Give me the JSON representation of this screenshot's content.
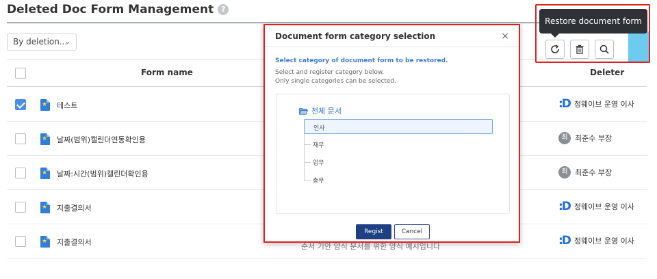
{
  "page": {
    "title": "Deleted Doc Form Management",
    "help_icon": "question-circle-icon"
  },
  "filter": {
    "sort_value": "By deletion..."
  },
  "table": {
    "headers": {
      "form_name": "Form name",
      "deleter": "Deleter"
    },
    "rows": [
      {
        "checked": true,
        "name": "테스트",
        "deleter": "정웨이브 운영 이사",
        "avatar": "D"
      },
      {
        "checked": false,
        "name": "날짜(범위)캘린더연동확인용",
        "deleter": "최준수 부장",
        "avatar": "최"
      },
      {
        "checked": false,
        "name": "날짜:시간(범위)캘린더확인용",
        "deleter": "최준수 부장",
        "avatar": "최"
      },
      {
        "checked": false,
        "name": "지출결의서",
        "deleter": "정웨이브 운영 이사",
        "avatar": "D"
      },
      {
        "checked": false,
        "name": "지출결의서",
        "deleter": "정웨이브 운영 이사",
        "avatar": "D"
      }
    ]
  },
  "toolbar": {
    "tooltip": "Restore document form",
    "restore_icon": "restore-icon",
    "delete_icon": "trash-icon",
    "search_icon": "search-icon"
  },
  "modal": {
    "title": "Document form category selection",
    "instruction": "Select category of document form to be restored.",
    "desc1": "Select and register category below.",
    "desc2": "Only single categories can be selected.",
    "tree": {
      "root": "전체 문서",
      "items": [
        "인사",
        "재무",
        "업무",
        "총무"
      ],
      "selected_index": 0
    },
    "regist_label": "Regist",
    "cancel_label": "Cancel"
  },
  "background_text": "순서 기안 양식 문서를 위한 양식 예시입니다"
}
